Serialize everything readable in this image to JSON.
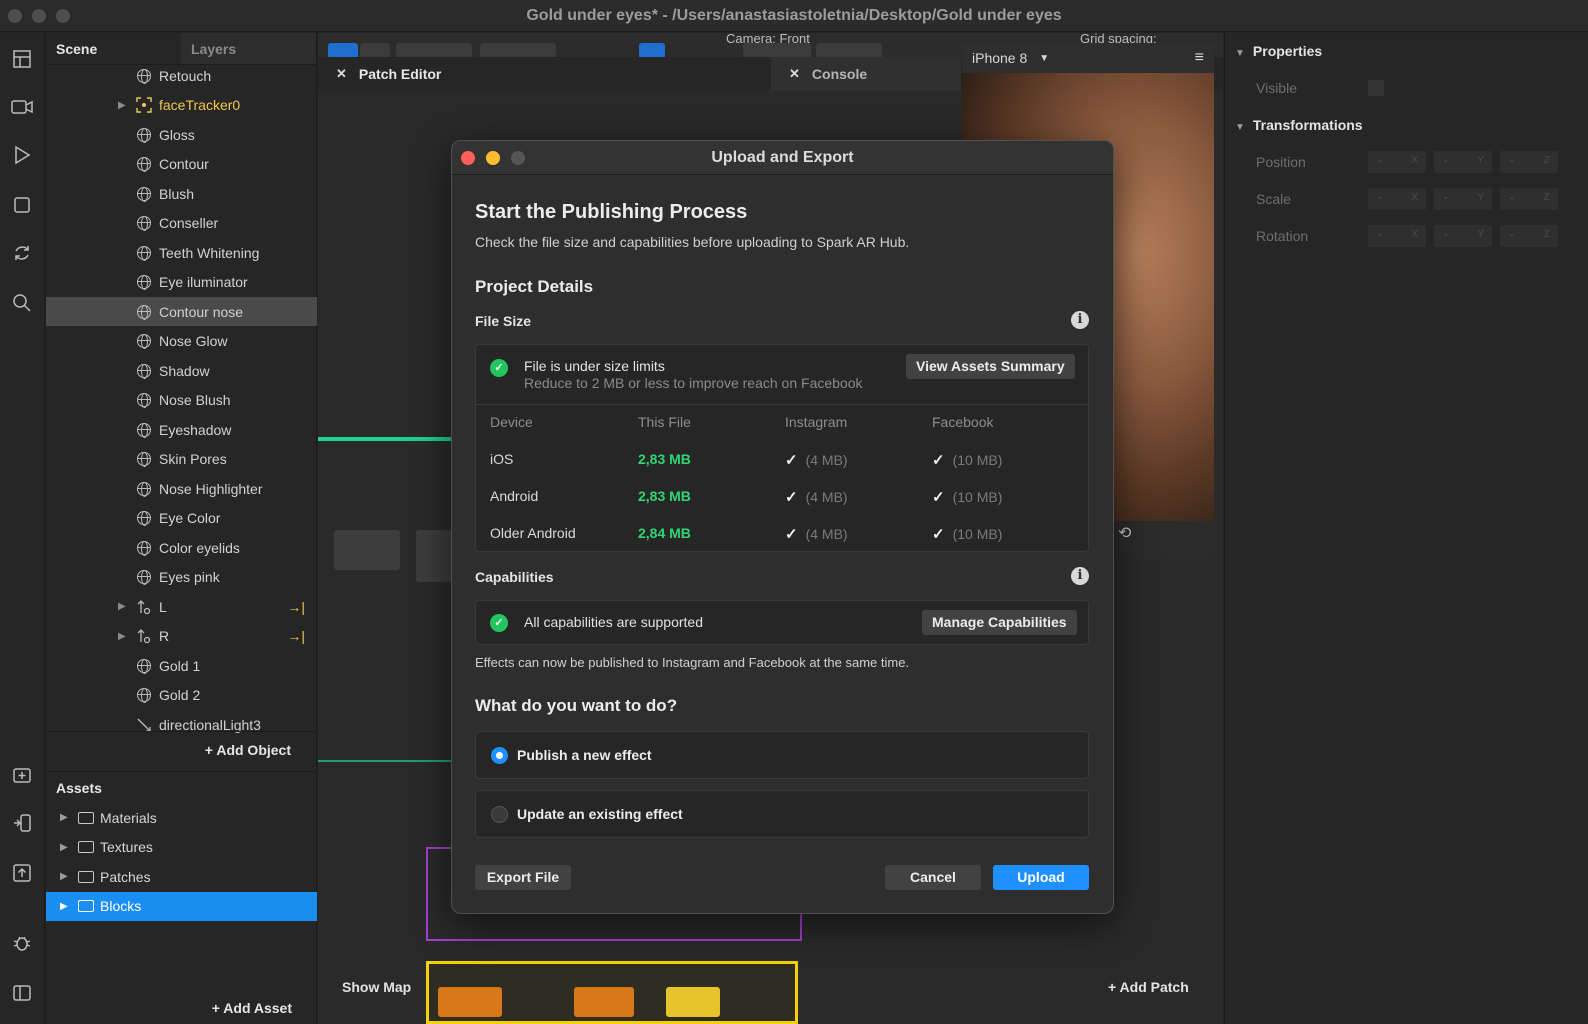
{
  "window": {
    "title": "Gold under eyes* - /Users/anastasiastoletnia/Desktop/Gold under eyes"
  },
  "scene": {
    "tabs": [
      "Scene",
      "Layers"
    ],
    "items": [
      {
        "label": "Retouch",
        "type": "globe"
      },
      {
        "label": "faceTracker0",
        "type": "tracker"
      },
      {
        "label": "Gloss",
        "type": "globe"
      },
      {
        "label": "Contour",
        "type": "globe"
      },
      {
        "label": "Blush",
        "type": "globe"
      },
      {
        "label": "Conseller",
        "type": "globe"
      },
      {
        "label": "Teeth Whitening",
        "type": "globe"
      },
      {
        "label": "Eye iluminator",
        "type": "globe"
      },
      {
        "label": "Contour nose",
        "type": "globe"
      },
      {
        "label": "Nose Glow",
        "type": "globe"
      },
      {
        "label": "Shadow",
        "type": "globe"
      },
      {
        "label": "Nose Blush",
        "type": "globe"
      },
      {
        "label": "Eyeshadow",
        "type": "globe"
      },
      {
        "label": "Skin Pores",
        "type": "globe"
      },
      {
        "label": "Nose Highlighter",
        "type": "globe"
      },
      {
        "label": "Eye Color",
        "type": "globe"
      },
      {
        "label": "Color eyelids",
        "type": "globe"
      },
      {
        "label": "Eyes pink",
        "type": "globe"
      },
      {
        "label": "L",
        "type": "null"
      },
      {
        "label": "R",
        "type": "null"
      },
      {
        "label": "Gold 1",
        "type": "globe"
      },
      {
        "label": "Gold 2",
        "type": "globe"
      },
      {
        "label": "directionalLight3",
        "type": "light"
      }
    ],
    "add_object": "Add Object"
  },
  "assets": {
    "header": "Assets",
    "items": [
      "Materials",
      "Textures",
      "Patches",
      "Blocks"
    ],
    "add_asset": "Add Asset"
  },
  "editor": {
    "tabs": [
      "Patch Editor",
      "Console"
    ],
    "camera_label": "Camera: Front",
    "grid_label": "Grid spacing:",
    "show_map": "Show Map",
    "add_patch": "Add Patch"
  },
  "viewport": {
    "device": "iPhone 8"
  },
  "properties": {
    "header": "Properties",
    "visible_label": "Visible",
    "transform_header": "Transformations",
    "rows": [
      "Position",
      "Scale",
      "Rotation"
    ],
    "axes": [
      "X",
      "Y",
      "Z"
    ],
    "placeholder": "-"
  },
  "modal": {
    "title": "Upload and Export",
    "heading": "Start the Publishing Process",
    "subheading": "Check the file size and capabilities before uploading to Spark AR Hub.",
    "project_details": "Project Details",
    "file_size_label": "File Size",
    "file_status": "File is under size limits",
    "file_hint": "Reduce to 2 MB or less to improve reach on Facebook",
    "view_assets": "View Assets Summary",
    "table_headers": [
      "Device",
      "This File",
      "Instagram",
      "Facebook"
    ],
    "table_rows": [
      {
        "device": "iOS",
        "size": "2,83 MB",
        "instagram": "(4 MB)",
        "facebook": "(10 MB)"
      },
      {
        "device": "Android",
        "size": "2,83 MB",
        "instagram": "(4 MB)",
        "facebook": "(10 MB)"
      },
      {
        "device": "Older Android",
        "size": "2,84 MB",
        "instagram": "(4 MB)",
        "facebook": "(10 MB)"
      }
    ],
    "capabilities_label": "Capabilities",
    "capabilities_status": "All capabilities are supported",
    "manage_capabilities": "Manage Capabilities",
    "capabilities_note": "Effects can now be published to Instagram and Facebook at the same time.",
    "question": "What do you want to do?",
    "options": [
      "Publish a new effect",
      "Update an existing effect"
    ],
    "export_button": "Export File",
    "cancel_button": "Cancel",
    "upload_button": "Upload"
  },
  "colors": {
    "accent": "#1e90ff",
    "success": "#22c55e",
    "size_green": "#2fd673",
    "tracker_yellow": "#f2c84a"
  }
}
